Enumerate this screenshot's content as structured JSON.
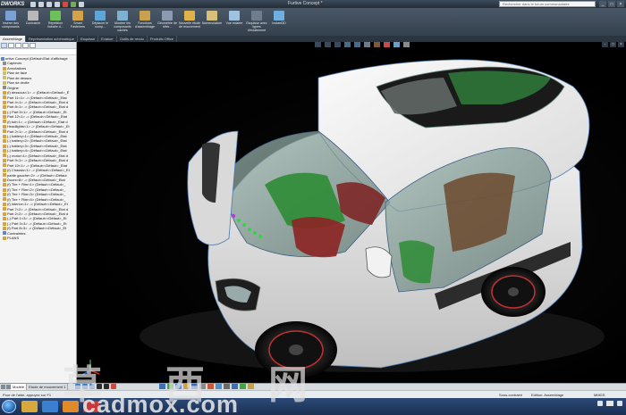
{
  "window": {
    "app_logo": "DWORKS",
    "document_title": "Furtive Concept *",
    "search_placeholder": "Rechercher dans le forum communautaire",
    "controls": [
      "_",
      "□",
      "×"
    ]
  },
  "quick_access": [
    "new-icon",
    "open-icon",
    "save-icon",
    "print-icon",
    "undo-icon",
    "rebuild-icon",
    "options-icon"
  ],
  "ribbon": [
    {
      "label": "Insérer des composants",
      "icon": "insert-component-icon",
      "color": "#7aa0d6"
    },
    {
      "label": "Contrainte",
      "icon": "mate-icon",
      "color": "#b8b8b8"
    },
    {
      "label": "Répétition linéaire d...",
      "icon": "linear-pattern-icon",
      "color": "#6fbf5a"
    },
    {
      "label": "Smart Fasteners",
      "icon": "smart-fasteners-icon",
      "color": "#d4a24a"
    },
    {
      "label": "Déplacer le comp...",
      "icon": "move-component-icon",
      "color": "#5fa6d8"
    },
    {
      "label": "Montrer les composants cachés",
      "icon": "show-hidden-icon",
      "color": "#7fb0d0"
    },
    {
      "label": "Fonctions d'assemblage",
      "icon": "assembly-features-icon",
      "color": "#c9a14e"
    },
    {
      "label": "Géométrie de référ...",
      "icon": "reference-geometry-icon",
      "color": "#8c9ab2"
    },
    {
      "label": "Nouvelle étude de mouvement",
      "icon": "motion-study-icon",
      "color": "#e0b24a"
    },
    {
      "label": "Nomenclature",
      "icon": "bom-icon",
      "color": "#d6c07a"
    },
    {
      "label": "Vue éclatée",
      "icon": "exploded-view-icon",
      "color": "#9fc2e0"
    },
    {
      "label": "Esquisse avec lignes d'éclatement",
      "icon": "explode-line-sketch-icon",
      "color": "#6f7d8d"
    },
    {
      "label": "Instant3D",
      "icon": "instant3d-icon",
      "color": "#6fb0e0"
    }
  ],
  "command_tabs": [
    {
      "label": "Assemblage",
      "active": true
    },
    {
      "label": "Représentation schématique",
      "active": false
    },
    {
      "label": "Esquisse",
      "active": false
    },
    {
      "label": "Evaluer",
      "active": false
    },
    {
      "label": "Outils de rendu",
      "active": false
    },
    {
      "label": "Produits Office",
      "active": false
    }
  ],
  "feature_tree": [
    {
      "label": "urtive Concept (Défaut<Etat d'affichage",
      "icon": "assembly-icon",
      "level": 0
    },
    {
      "label": "Capteurs",
      "icon": "sensor-icon",
      "level": 1
    },
    {
      "label": "Annotations",
      "icon": "annotation-icon",
      "level": 1
    },
    {
      "label": "Plan de face",
      "icon": "plane-icon",
      "level": 1
    },
    {
      "label": "Plan de dessus",
      "icon": "plane-icon",
      "level": 1
    },
    {
      "label": "Plan de droite",
      "icon": "plane-icon",
      "level": 1
    },
    {
      "label": "Origine",
      "icon": "origin-icon",
      "level": 1
    },
    {
      "label": "(f) dessous<1> -> (Défaut<<Défaut>_É",
      "icon": "part-icon",
      "level": 1
    },
    {
      "label": "Part 11<1> -> (Défaut<<Défaut>_Etat",
      "icon": "part-icon",
      "level": 1
    },
    {
      "label": "Part 4<1> -> (Défaut<<Défaut>_Etat d",
      "icon": "part-icon",
      "level": 1
    },
    {
      "label": "Part 8<1> -> (Défaut<<Défaut>_Etat d",
      "icon": "part-icon",
      "level": 1
    },
    {
      "label": "(-) Part 5<1> -> (Défaut<<Défaut>_Et",
      "icon": "part-icon",
      "level": 1
    },
    {
      "label": "Part 12<1> -> (Défaut<<Défaut>_Etat",
      "icon": "part-icon",
      "level": 1
    },
    {
      "label": "(f) toit<1> -> (Défaut<<Défaut>_Etat d",
      "icon": "part-icon",
      "level": 1
    },
    {
      "label": "Headlights<1> -> (Défaut<<Défaut>_Et",
      "icon": "part-icon",
      "level": 1
    },
    {
      "label": "Part 2<1> -> (Défaut<<Défaut>_Etat d",
      "icon": "part-icon",
      "level": 1
    },
    {
      "label": "(-) battery<1> (Défaut<<Défaut>_Etat",
      "icon": "part-icon",
      "level": 1
    },
    {
      "label": "(-) battery<2> (Défaut<<Défaut>_Etat",
      "icon": "part-icon",
      "level": 1
    },
    {
      "label": "(-) battery<3> (Défaut<<Défaut>_Etat",
      "icon": "part-icon",
      "level": 1
    },
    {
      "label": "(-) battery<4> (Défaut<<Défaut>_Etat",
      "icon": "part-icon",
      "level": 1
    },
    {
      "label": "(-) motor<1> (Défaut<<Défaut>_Etat d",
      "icon": "part-icon",
      "level": 1
    },
    {
      "label": "Part 9<1> -> (Défaut<<Défaut>_Etat d",
      "icon": "part-icon",
      "level": 1
    },
    {
      "label": "Part 10<1> -> (Défaut<<Défaut>_Etat",
      "icon": "part-icon",
      "level": 1
    },
    {
      "label": "(f) Chassis<1> -> (Défaut<<Défaut>_Et",
      "icon": "part-icon",
      "level": 1
    },
    {
      "label": "partie gauche<2> -> (Défaut<<Défaut",
      "icon": "part-icon",
      "level": 1
    },
    {
      "label": "Doors<8> -> (Défaut<<Défaut>_Etat",
      "icon": "part-icon",
      "level": 1
    },
    {
      "label": "(f) Tire + Rim<1> (Défaut<<Défaut>_",
      "icon": "part-icon",
      "level": 1
    },
    {
      "label": "(f) Tire + Rim<2> (Défaut<<Défaut>_",
      "icon": "part-icon",
      "level": 1
    },
    {
      "label": "(f) Tire + Rim<3> (Défaut<<Défaut>_",
      "icon": "part-icon",
      "level": 1
    },
    {
      "label": "(f) Tire + Rim<4> (Défaut<<Défaut>_",
      "icon": "part-icon",
      "level": 1
    },
    {
      "label": "(f) interior<1> -> (Défaut<<Défaut>_Et",
      "icon": "part-icon",
      "level": 1
    },
    {
      "label": "Part 7<2> -> (Défaut<<Défaut>_Etat d",
      "icon": "part-icon",
      "level": 1
    },
    {
      "label": "Part 2<2> -> (Défaut<<Défaut>_Etat d",
      "icon": "part-icon",
      "level": 1
    },
    {
      "label": "(-) Part 1<3> -> (Défaut<<Défaut>_Et",
      "icon": "part-icon",
      "level": 1
    },
    {
      "label": "(-) Part 3<3> -> (Défaut<<Défaut>_Et",
      "icon": "part-icon",
      "level": 1
    },
    {
      "label": "(f) Part 8<3> -> (Défaut<<Défaut>_Et",
      "icon": "part-icon",
      "level": 1
    },
    {
      "label": "Contraintes",
      "icon": "mates-icon",
      "level": 1
    },
    {
      "label": "PLANS",
      "icon": "folder-icon",
      "level": 1
    }
  ],
  "bottom_tabs": [
    {
      "label": "Modèle",
      "active": true
    },
    {
      "label": "Etude de mouvement 1",
      "active": false
    }
  ],
  "status": {
    "message": "Pour de l'aide, appuyez sur F1",
    "constraint": "Sous-contraint",
    "mode": "Edition: Assemblage",
    "units": "MMGS"
  },
  "watermark": {
    "text": "草 西 网",
    "url": "cadmox.com"
  },
  "colors": {
    "body_paint": "#e8e8e8",
    "glass": "#8fa8a0",
    "seat_green": "#3a9a3a",
    "seat_red": "#9a2a2a",
    "accent_blue": "#2f7dd0"
  }
}
